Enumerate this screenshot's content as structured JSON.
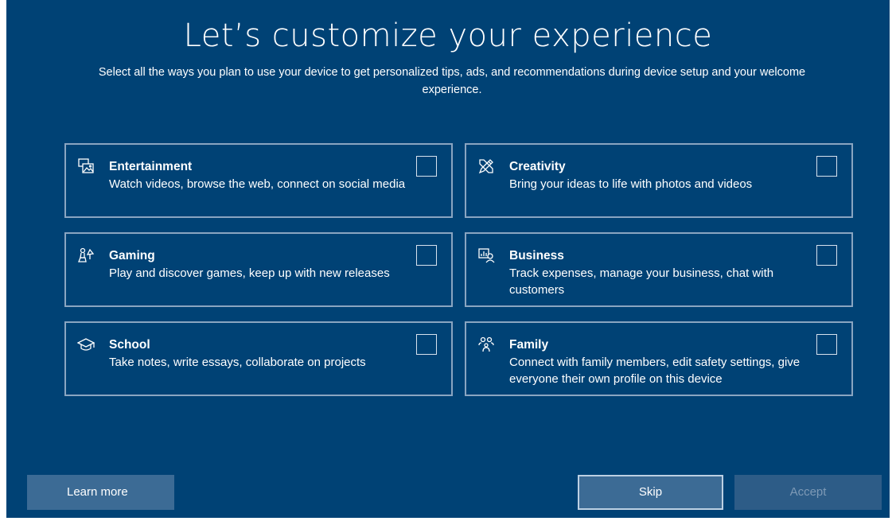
{
  "page": {
    "title": "Let’s customize your experience",
    "subtitle": "Select all the ways you plan to use your device to get personalized tips, ads, and recommendations during device setup and your welcome experience."
  },
  "options": [
    {
      "name": "Entertainment",
      "description": "Watch videos, browse the web, connect on social media",
      "icon": "entertainment-icon",
      "checked": false
    },
    {
      "name": "Creativity",
      "description": "Bring your ideas to life with photos and videos",
      "icon": "creativity-icon",
      "checked": false
    },
    {
      "name": "Gaming",
      "description": "Play and discover games, keep up with new releases",
      "icon": "gaming-icon",
      "checked": false
    },
    {
      "name": "Business",
      "description": "Track expenses, manage your business, chat with customers",
      "icon": "business-icon",
      "checked": false
    },
    {
      "name": "School",
      "description": "Take notes, write essays, collaborate on projects",
      "icon": "school-icon",
      "checked": false
    },
    {
      "name": "Family",
      "description": "Connect with family members, edit safety settings, give everyone their own profile on this device",
      "icon": "family-icon",
      "checked": false
    }
  ],
  "buttons": {
    "learn_more": "Learn more",
    "skip": "Skip",
    "accept": "Accept",
    "accept_enabled": false
  },
  "colors": {
    "background": "#004275",
    "card_border": "#8aa5c1",
    "button": "#3c6b95",
    "button_disabled": "#2d5c87",
    "text": "#ffffff"
  }
}
